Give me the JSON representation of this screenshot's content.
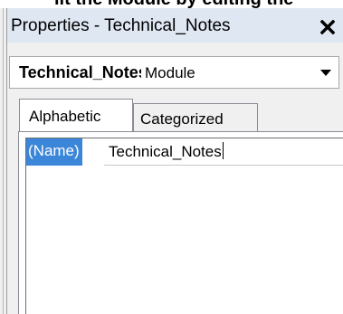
{
  "window": {
    "title": "Properties - Technical_Notes",
    "close_icon": "close-icon"
  },
  "object_selector": {
    "name": "Technical_Notes",
    "type": "Module",
    "arrow_icon": "dropdown-arrow-icon"
  },
  "tabs": [
    {
      "label": "Alphabetic",
      "selected": true
    },
    {
      "label": "Categorized",
      "selected": false
    }
  ],
  "properties": [
    {
      "name": "(Name)",
      "value": "Technical_Notes",
      "selected": true
    }
  ],
  "colors": {
    "selection": "#3b86d9",
    "titlebar": "#dfe7f2",
    "background": "#f0f0f0"
  }
}
